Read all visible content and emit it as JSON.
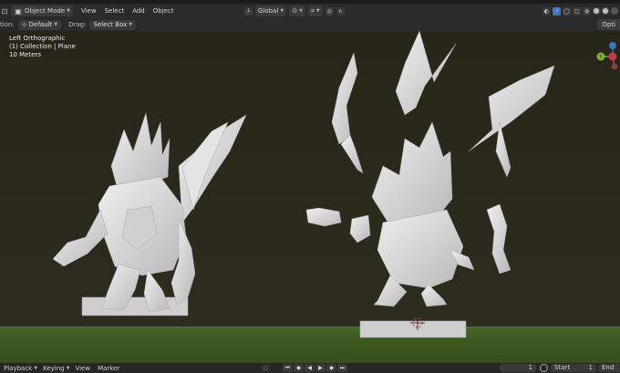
{
  "header": {
    "mode": "Object Mode",
    "menus": [
      "View",
      "Select",
      "Add",
      "Object"
    ],
    "transform_orientation": "Global"
  },
  "tool_settings": {
    "orientation_label": "tion:",
    "orientation_value": "Default",
    "drag_label": "Drag:",
    "drag_value": "Select Box",
    "options_label": "Opti"
  },
  "viewport": {
    "view_name": "Left Orthographic",
    "collection_info": "(1) Collection | Plane",
    "scale_info": "10 Meters",
    "gizmo_axes": {
      "y": "Y",
      "z": "Z",
      "x": "X"
    },
    "colors": {
      "background": "#262619",
      "ground": "#3e5a22",
      "model": "#d9d9d9"
    }
  },
  "timeline": {
    "playback": "Playback",
    "keying": "Keying",
    "view": "View",
    "marker": "Marker",
    "current_frame": "1",
    "start_label": "Start",
    "start_value": "1",
    "end_label": "End"
  }
}
